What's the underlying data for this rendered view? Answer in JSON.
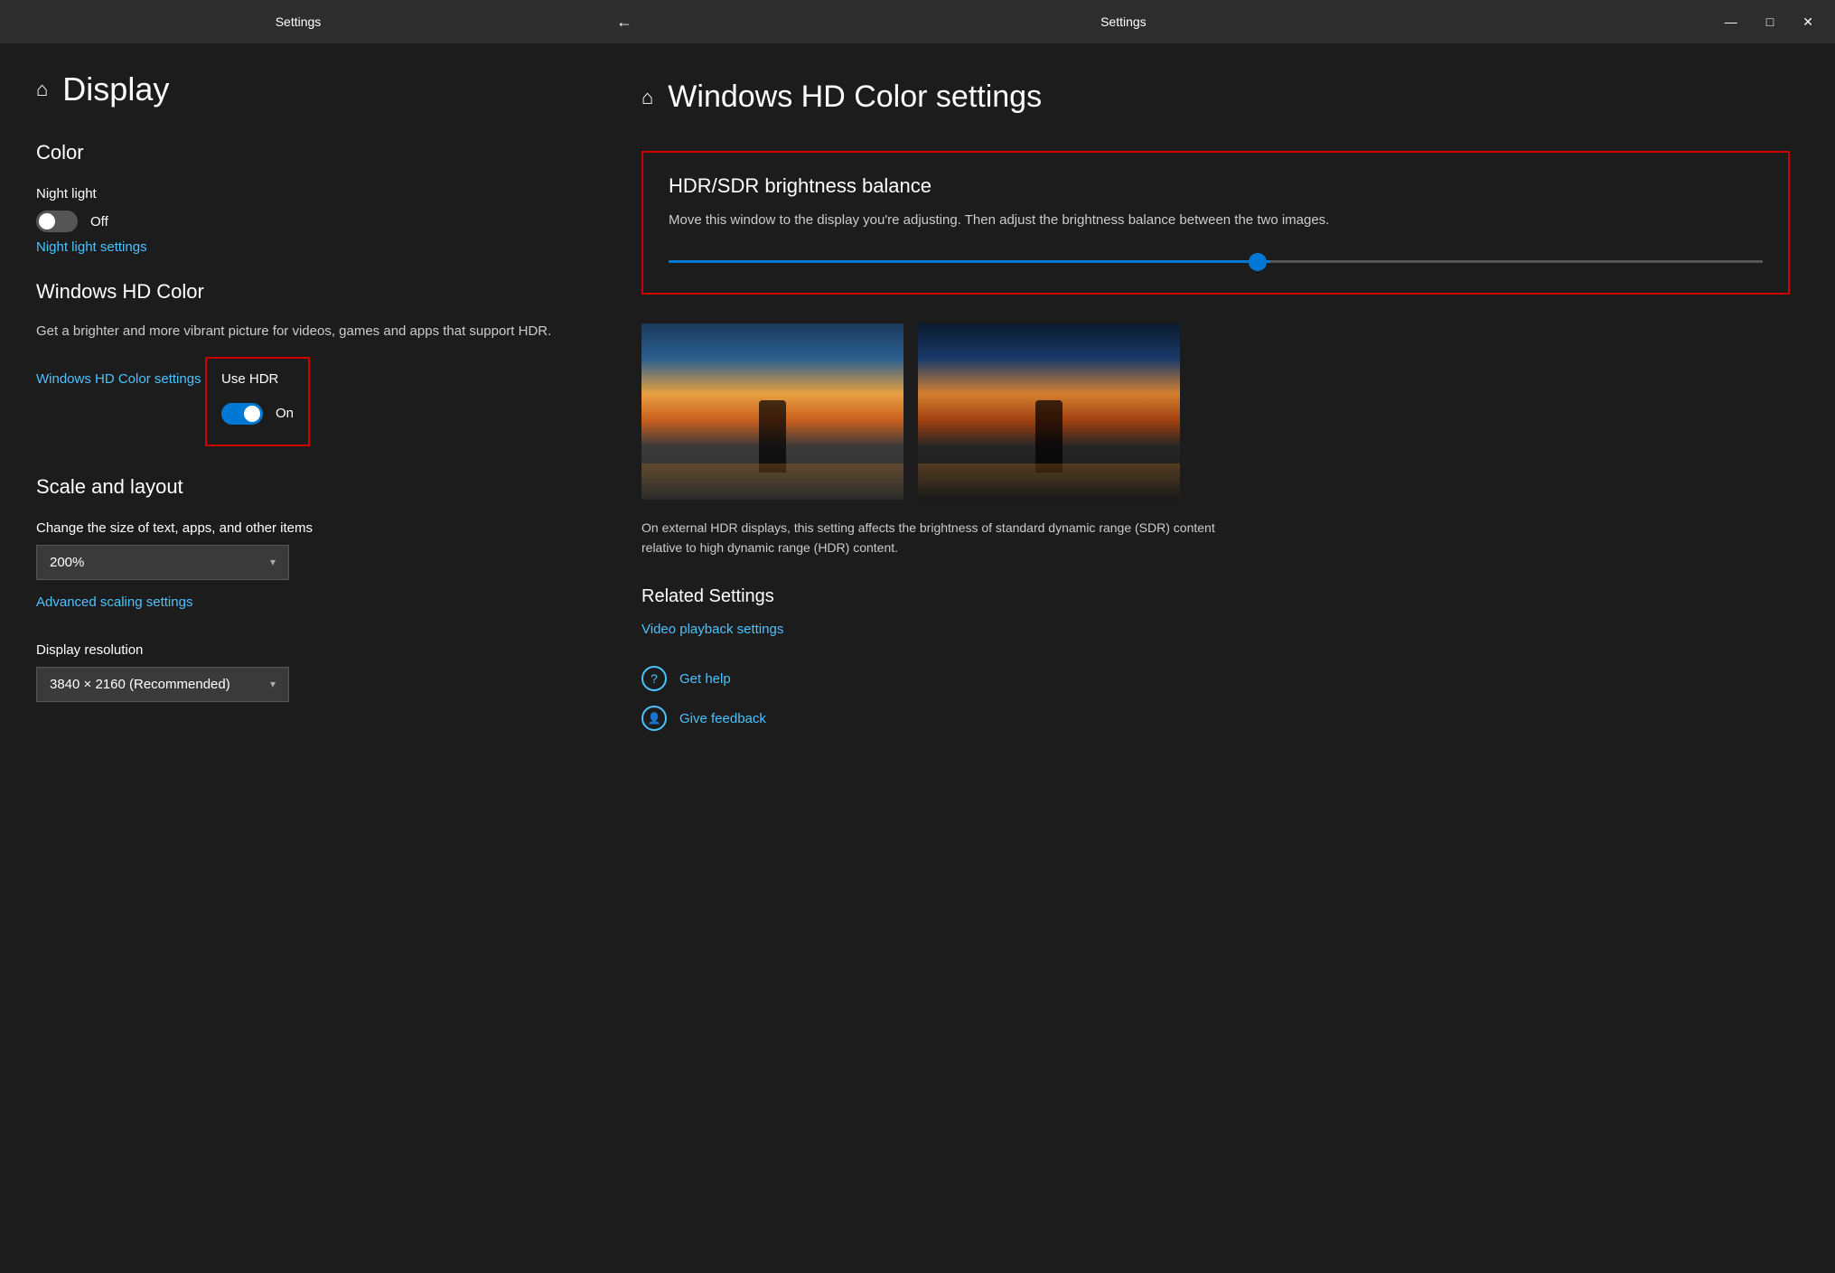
{
  "left": {
    "titlebar": "Settings",
    "page_title": "Display",
    "home_icon": "⌂",
    "sections": {
      "color": {
        "title": "Color",
        "night_light": {
          "label": "Night light",
          "state": "Off"
        },
        "night_light_link": "Night light settings",
        "windows_hd_color": {
          "title": "Windows HD Color",
          "description": "Get a brighter and more vibrant picture for videos, games and apps that support HDR.",
          "link": "Windows HD Color settings"
        },
        "use_hdr": {
          "label": "Use HDR",
          "state": "On"
        }
      },
      "scale_layout": {
        "title": "Scale and layout",
        "change_size_label": "Change the size of text, apps, and other items",
        "scale_value": "200%",
        "advanced_link": "Advanced scaling settings",
        "resolution_label": "Display resolution",
        "resolution_value": "3840 × 2160 (Recommended)"
      }
    }
  },
  "right": {
    "titlebar": "Settings",
    "back_icon": "←",
    "minimize_icon": "—",
    "maximize_icon": "□",
    "close_icon": "✕",
    "page_title": "Windows HD Color settings",
    "home_icon": "⌂",
    "hdr_brightness": {
      "title": "HDR/SDR brightness balance",
      "description": "Move this window to the display you're adjusting. Then adjust the brightness balance between the two images.",
      "slider_value": 55
    },
    "caption": "On external HDR displays, this setting affects the brightness of standard dynamic range (SDR) content relative to high dynamic range (HDR) content.",
    "related_settings": {
      "title": "Related Settings",
      "video_playback_link": "Video playback settings"
    },
    "get_help": {
      "label": "Get help",
      "icon": "?"
    },
    "give_feedback": {
      "label": "Give feedback",
      "icon": "👤"
    }
  }
}
